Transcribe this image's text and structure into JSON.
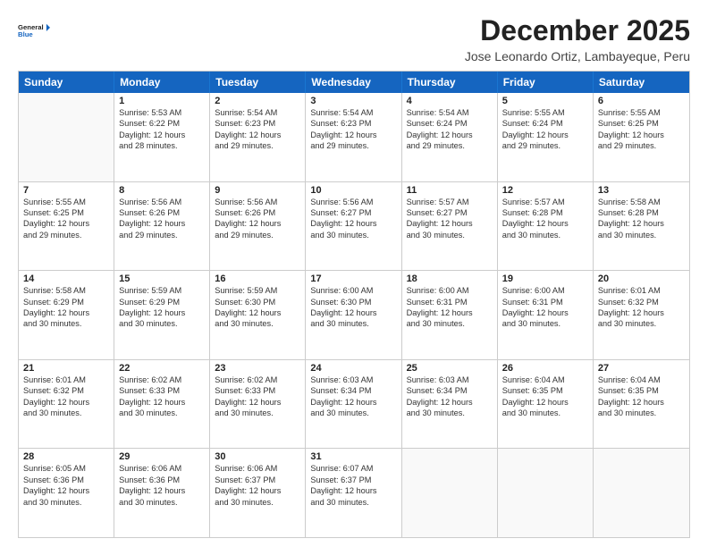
{
  "logo": {
    "line1": "General",
    "line2": "Blue"
  },
  "header": {
    "month": "December 2025",
    "location": "Jose Leonardo Ortiz, Lambayeque, Peru"
  },
  "days": [
    "Sunday",
    "Monday",
    "Tuesday",
    "Wednesday",
    "Thursday",
    "Friday",
    "Saturday"
  ],
  "weeks": [
    [
      {
        "day": "",
        "empty": true
      },
      {
        "day": "1",
        "sunrise": "5:53 AM",
        "sunset": "6:22 PM",
        "daylight": "12 hours and 28 minutes."
      },
      {
        "day": "2",
        "sunrise": "5:54 AM",
        "sunset": "6:23 PM",
        "daylight": "12 hours and 29 minutes."
      },
      {
        "day": "3",
        "sunrise": "5:54 AM",
        "sunset": "6:23 PM",
        "daylight": "12 hours and 29 minutes."
      },
      {
        "day": "4",
        "sunrise": "5:54 AM",
        "sunset": "6:24 PM",
        "daylight": "12 hours and 29 minutes."
      },
      {
        "day": "5",
        "sunrise": "5:55 AM",
        "sunset": "6:24 PM",
        "daylight": "12 hours and 29 minutes."
      },
      {
        "day": "6",
        "sunrise": "5:55 AM",
        "sunset": "6:25 PM",
        "daylight": "12 hours and 29 minutes."
      }
    ],
    [
      {
        "day": "7",
        "sunrise": "5:55 AM",
        "sunset": "6:25 PM",
        "daylight": "12 hours and 29 minutes."
      },
      {
        "day": "8",
        "sunrise": "5:56 AM",
        "sunset": "6:26 PM",
        "daylight": "12 hours and 29 minutes."
      },
      {
        "day": "9",
        "sunrise": "5:56 AM",
        "sunset": "6:26 PM",
        "daylight": "12 hours and 29 minutes."
      },
      {
        "day": "10",
        "sunrise": "5:56 AM",
        "sunset": "6:27 PM",
        "daylight": "12 hours and 30 minutes."
      },
      {
        "day": "11",
        "sunrise": "5:57 AM",
        "sunset": "6:27 PM",
        "daylight": "12 hours and 30 minutes."
      },
      {
        "day": "12",
        "sunrise": "5:57 AM",
        "sunset": "6:28 PM",
        "daylight": "12 hours and 30 minutes."
      },
      {
        "day": "13",
        "sunrise": "5:58 AM",
        "sunset": "6:28 PM",
        "daylight": "12 hours and 30 minutes."
      }
    ],
    [
      {
        "day": "14",
        "sunrise": "5:58 AM",
        "sunset": "6:29 PM",
        "daylight": "12 hours and 30 minutes."
      },
      {
        "day": "15",
        "sunrise": "5:59 AM",
        "sunset": "6:29 PM",
        "daylight": "12 hours and 30 minutes."
      },
      {
        "day": "16",
        "sunrise": "5:59 AM",
        "sunset": "6:30 PM",
        "daylight": "12 hours and 30 minutes."
      },
      {
        "day": "17",
        "sunrise": "6:00 AM",
        "sunset": "6:30 PM",
        "daylight": "12 hours and 30 minutes."
      },
      {
        "day": "18",
        "sunrise": "6:00 AM",
        "sunset": "6:31 PM",
        "daylight": "12 hours and 30 minutes."
      },
      {
        "day": "19",
        "sunrise": "6:00 AM",
        "sunset": "6:31 PM",
        "daylight": "12 hours and 30 minutes."
      },
      {
        "day": "20",
        "sunrise": "6:01 AM",
        "sunset": "6:32 PM",
        "daylight": "12 hours and 30 minutes."
      }
    ],
    [
      {
        "day": "21",
        "sunrise": "6:01 AM",
        "sunset": "6:32 PM",
        "daylight": "12 hours and 30 minutes."
      },
      {
        "day": "22",
        "sunrise": "6:02 AM",
        "sunset": "6:33 PM",
        "daylight": "12 hours and 30 minutes."
      },
      {
        "day": "23",
        "sunrise": "6:02 AM",
        "sunset": "6:33 PM",
        "daylight": "12 hours and 30 minutes."
      },
      {
        "day": "24",
        "sunrise": "6:03 AM",
        "sunset": "6:34 PM",
        "daylight": "12 hours and 30 minutes."
      },
      {
        "day": "25",
        "sunrise": "6:03 AM",
        "sunset": "6:34 PM",
        "daylight": "12 hours and 30 minutes."
      },
      {
        "day": "26",
        "sunrise": "6:04 AM",
        "sunset": "6:35 PM",
        "daylight": "12 hours and 30 minutes."
      },
      {
        "day": "27",
        "sunrise": "6:04 AM",
        "sunset": "6:35 PM",
        "daylight": "12 hours and 30 minutes."
      }
    ],
    [
      {
        "day": "28",
        "sunrise": "6:05 AM",
        "sunset": "6:36 PM",
        "daylight": "12 hours and 30 minutes."
      },
      {
        "day": "29",
        "sunrise": "6:06 AM",
        "sunset": "6:36 PM",
        "daylight": "12 hours and 30 minutes."
      },
      {
        "day": "30",
        "sunrise": "6:06 AM",
        "sunset": "6:37 PM",
        "daylight": "12 hours and 30 minutes."
      },
      {
        "day": "31",
        "sunrise": "6:07 AM",
        "sunset": "6:37 PM",
        "daylight": "12 hours and 30 minutes."
      },
      {
        "day": "",
        "empty": true
      },
      {
        "day": "",
        "empty": true
      },
      {
        "day": "",
        "empty": true
      }
    ]
  ]
}
